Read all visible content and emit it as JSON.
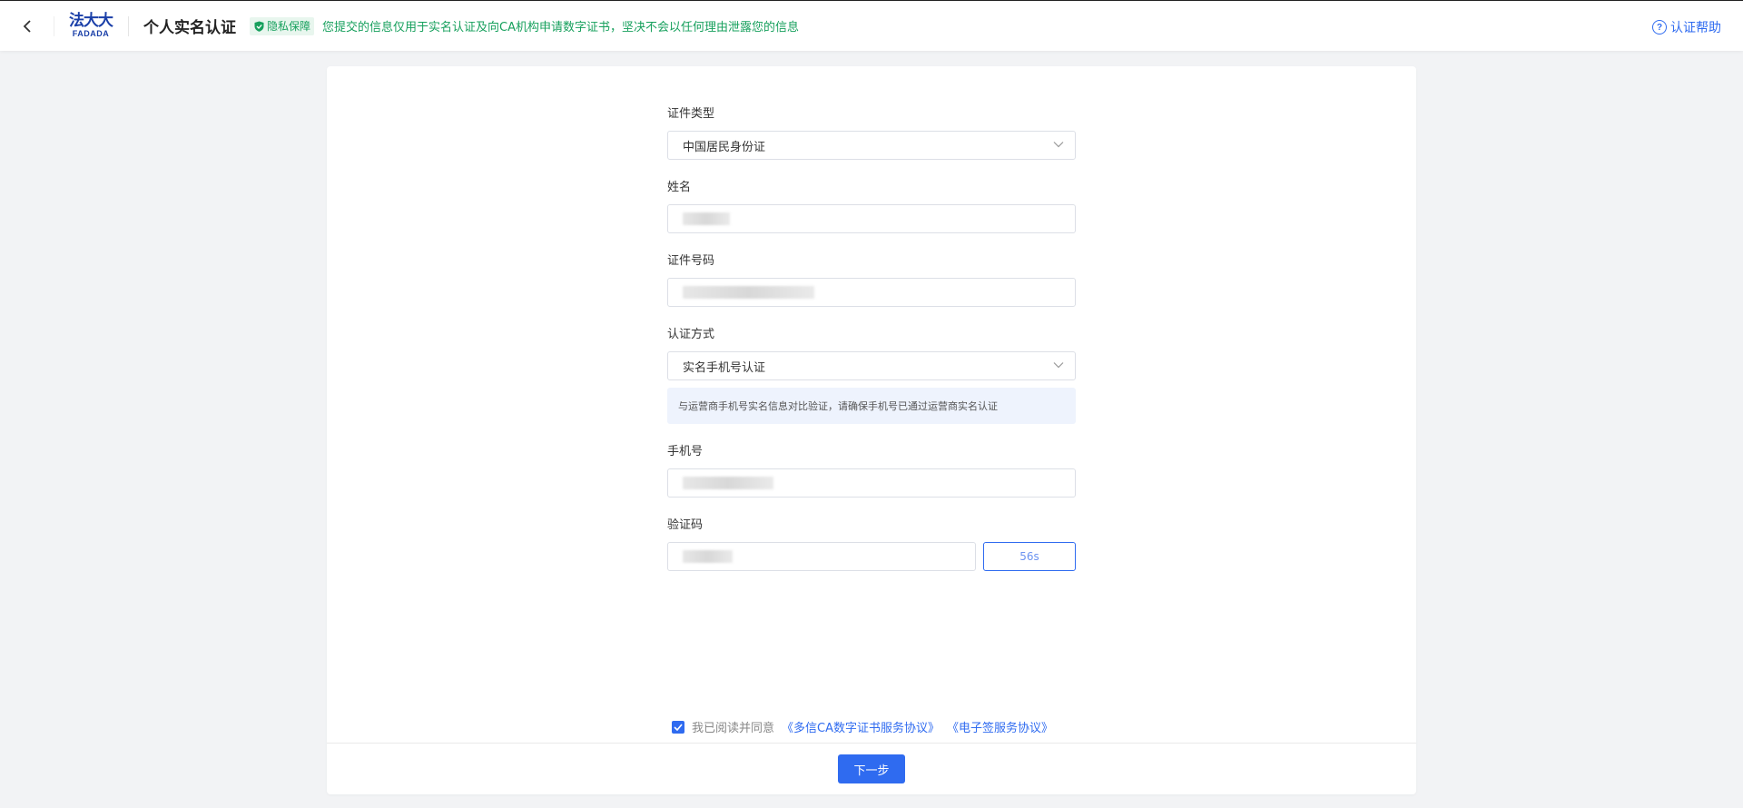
{
  "header": {
    "logo_cn": "法大大",
    "logo_en": "FADADA",
    "title": "个人实名认证",
    "privacy_badge": "隐私保障",
    "privacy_text": "您提交的信息仅用于实名认证及向CA机构申请数字证书，坚决不会以任何理由泄露您的信息",
    "help_label": "认证帮助",
    "help_icon": "question-circle-icon",
    "back_icon": "chevron-left-icon"
  },
  "form": {
    "id_type": {
      "label": "证件类型",
      "value": "中国居民身份证"
    },
    "name": {
      "label": "姓名"
    },
    "id_number": {
      "label": "证件号码"
    },
    "auth_method": {
      "label": "认证方式",
      "value": "实名手机号认证",
      "hint": "与运营商手机号实名信息对比验证，请确保手机号已通过运营商实名认证"
    },
    "phone": {
      "label": "手机号"
    },
    "code": {
      "label": "验证码",
      "countdown": "56s"
    }
  },
  "agreement": {
    "checked": true,
    "text": "我已阅读并同意",
    "link1": "《多信CA数字证书服务协议》",
    "link2": "《电子签服务协议》"
  },
  "footer": {
    "next_label": "下一步"
  },
  "colors": {
    "primary": "#2f6bf0",
    "success": "#17a05d",
    "brand": "#1a3fa8"
  }
}
